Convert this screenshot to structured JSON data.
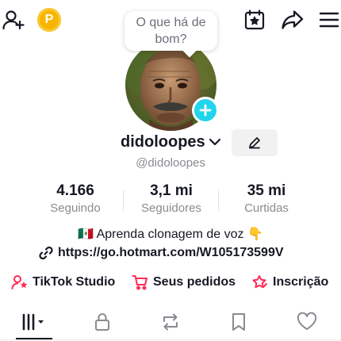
{
  "status_bubble": {
    "text": "O que há de\nbom?"
  },
  "coin": {
    "letter": "P"
  },
  "profile": {
    "username": "didoloopes",
    "handle": "@didoloopes"
  },
  "stats": [
    {
      "value": "4.166",
      "label": "Seguindo"
    },
    {
      "value": "3,1 mi",
      "label": "Seguidores"
    },
    {
      "value": "35 mi",
      "label": "Curtidas"
    }
  ],
  "bio": {
    "line1": "🇲🇽 Aprenda clonagem de voz 👇",
    "link": "https://go.hotmart.com/W105173599V"
  },
  "actions": [
    {
      "label": "TikTok Studio"
    },
    {
      "label": "Seus pedidos"
    },
    {
      "label": "Inscrição"
    }
  ],
  "colors": {
    "accent_cyan": "#20d5ec",
    "accent_pink": "#fe2c55",
    "coin": "#f7b500",
    "text_primary": "#161823",
    "text_secondary": "#8a8b91"
  },
  "icons": {
    "top_left": [
      "add-user-icon",
      "coin-icon"
    ],
    "top_right": [
      "calendar-star-icon",
      "share-icon",
      "menu-icon"
    ],
    "tabs": [
      "grid-icon",
      "lock-icon",
      "repost-icon",
      "bookmark-icon",
      "heart-icon"
    ]
  }
}
